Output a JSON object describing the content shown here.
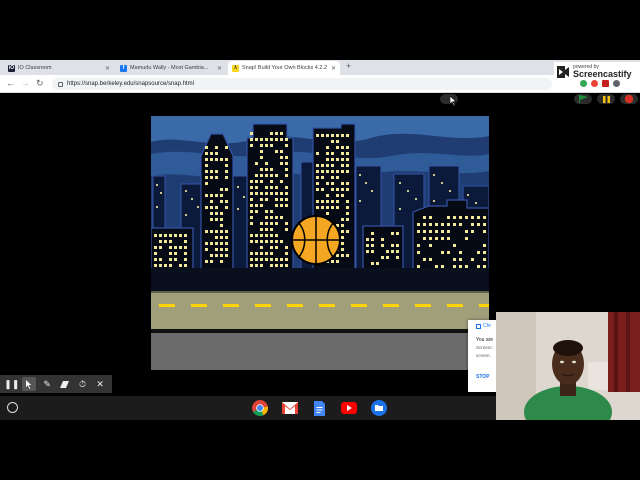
{
  "browser": {
    "tabs": [
      {
        "label": "IO Classroom",
        "fav_color": "#1a1f36",
        "fav_text": "iO"
      },
      {
        "label": "Mamudu Wally - Most Gambia...",
        "fav_color": "#1877f2",
        "fav_text": "f"
      },
      {
        "label": "Snap! Build Your Own Blocks 4.2.2",
        "fav_color": "#f9d71c",
        "fav_text": "λ"
      }
    ],
    "url": "https://snap.berkeley.edu/snapsource/snap.html"
  },
  "screencastify": {
    "powered": "powered by",
    "brand": "Screencastify"
  },
  "popup": {
    "header": "Chr",
    "title": "You are",
    "line1": "Screenc",
    "line2": "screen.",
    "stop": "STOP"
  },
  "colors": {
    "sky": "#2a4f8a",
    "building": "#050a14",
    "window": "#f3e79a",
    "road": "#a09f7a",
    "lane": "#ffd400",
    "ball": "#f5a623",
    "go": "#1e8e3e",
    "pause": "#f4c20d",
    "stop": "#d93025"
  }
}
